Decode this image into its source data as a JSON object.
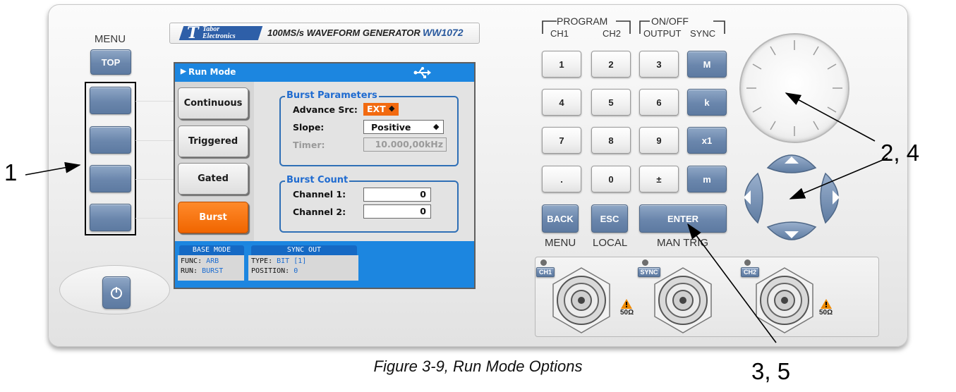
{
  "brand": {
    "logo_letter": "T",
    "logo_line1": "Tabor",
    "logo_line2": "Electronics",
    "product": "100MS/s WAVEFORM GENERATOR",
    "model": "WW1072"
  },
  "left_panel": {
    "menu_label": "MENU",
    "top_button": "TOP",
    "softkeys": [
      "",
      "",
      "",
      ""
    ],
    "power_icon": "power-icon"
  },
  "screen": {
    "title": "Run Mode",
    "usb_icon": "usb-icon",
    "modes": [
      {
        "label": "Continuous",
        "active": false
      },
      {
        "label": "Triggered",
        "active": false
      },
      {
        "label": "Gated",
        "active": false
      },
      {
        "label": "Burst",
        "active": true
      }
    ],
    "burst_parameters": {
      "title": "Burst Parameters",
      "advance_src_label": "Advance Src:",
      "advance_src_value": "EXT",
      "slope_label": "Slope:",
      "slope_value": "Positive",
      "timer_label": "Timer:",
      "timer_value": "10.000,00kHz"
    },
    "burst_count": {
      "title": "Burst Count",
      "ch1_label": "Channel 1:",
      "ch1_value": "0",
      "ch2_label": "Channel 2:",
      "ch2_value": "0"
    },
    "status": {
      "base_mode_tab": "BASE MODE",
      "func_label": "FUNC:",
      "func_value": "ARB",
      "run_label": "RUN:",
      "run_value": "BURST",
      "sync_tab": "SYNC OUT",
      "type_label": "TYPE:",
      "type_value": "BIT [1]",
      "position_label": "POSITION:",
      "position_value": "0"
    }
  },
  "keypad": {
    "program_label": "PROGRAM",
    "ch1_label": "CH1",
    "ch2_label": "CH2",
    "onoff_label": "ON/OFF",
    "output_label": "OUTPUT",
    "sync_label": "SYNC",
    "digits": [
      "1",
      "2",
      "3",
      "4",
      "5",
      "6",
      "7",
      "8",
      "9",
      ".",
      "0",
      "±"
    ],
    "units": [
      "M",
      "k",
      "x1",
      "m"
    ],
    "back": "BACK",
    "esc": "ESC",
    "enter": "ENTER",
    "menu_sub": "MENU",
    "local_sub": "LOCAL",
    "mantrig_sub": "MAN TRIG"
  },
  "connectors": {
    "ch1": "CH1",
    "sync": "SYNC",
    "ch2": "CH2",
    "impedance": "50Ω"
  },
  "callouts": {
    "c1": "1",
    "c24": "2, 4",
    "c35": "3, 5"
  },
  "caption": "Figure 3-9, Run Mode Options"
}
